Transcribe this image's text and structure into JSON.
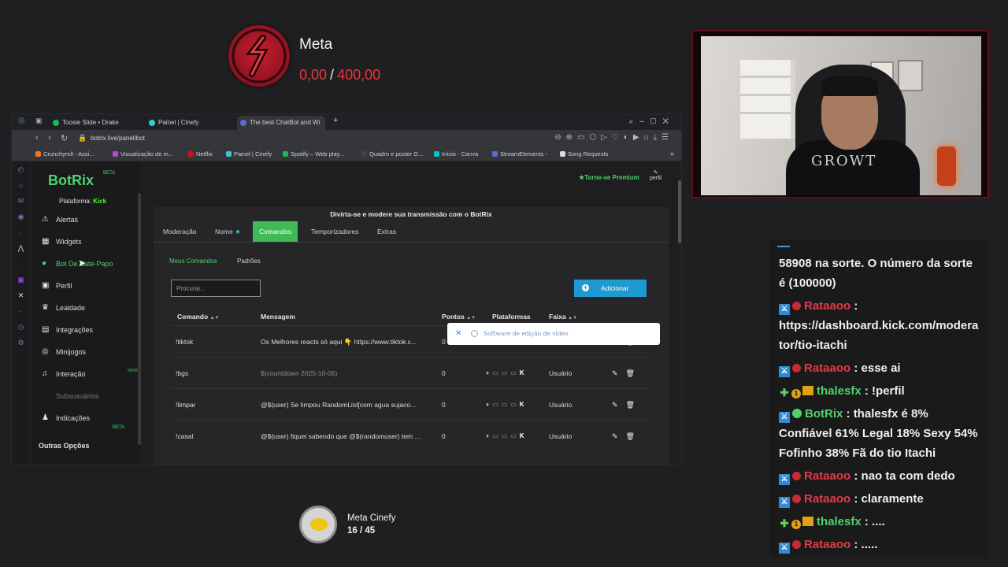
{
  "meta_top": {
    "title": "Meta",
    "current": "0,00",
    "separator": "/",
    "goal": "400,00",
    "accent": "#e8383f"
  },
  "meta_bottom": {
    "title": "Meta Cinefy",
    "progress": "16 / 45"
  },
  "webcam": {
    "shirt_text": "GROWT"
  },
  "browser": {
    "tabs": [
      {
        "label": "Toosie Slide • Drake",
        "color": "#1db954"
      },
      {
        "label": "Painel | Cinefy",
        "color": "#37c9d8"
      },
      {
        "label": "The best ChatBot and Wi",
        "color": "#5b6ad6"
      }
    ],
    "new_tab": "+",
    "url": "botrix.live/panel/bot",
    "bookmarks": [
      {
        "label": "Crunchyroll - Assi...",
        "color": "#f47521"
      },
      {
        "label": "Visualização de m...",
        "color": "#b04bd6"
      },
      {
        "label": "Netflix",
        "color": "#e50914"
      },
      {
        "label": "Painel | Cinefy",
        "color": "#37c9d8"
      },
      {
        "label": "Spotify – Web play...",
        "color": "#1db954"
      },
      {
        "label": "Quadro e poster G...",
        "color": "#444444"
      },
      {
        "label": "Início - Canva",
        "color": "#00c4cc"
      },
      {
        "label": "StreamElements -",
        "color": "#5b6ad6"
      },
      {
        "label": "Song Requests",
        "color": "#dddddd"
      }
    ]
  },
  "botrix": {
    "brand": "BotRix",
    "beta": "BETA",
    "platform_label": "Plataforma:",
    "platform": "Kick",
    "premium": "★Torne-se Premium",
    "profile": "perfil",
    "menu": [
      {
        "label": "Alertas",
        "icon": "⚠"
      },
      {
        "label": "Widgets",
        "icon": "▦"
      },
      {
        "label": "Bot De Bate-Papo",
        "icon": "●"
      },
      {
        "label": "Perfil",
        "icon": "▣"
      },
      {
        "label": "Lealdade",
        "icon": "♛"
      },
      {
        "label": "Integrações",
        "icon": "▤"
      },
      {
        "label": "Minijogos",
        "icon": "◎"
      },
      {
        "label": "Interação",
        "icon": "♫",
        "tag": "NOVO"
      },
      {
        "label": "Subsusuários",
        "icon": ""
      },
      {
        "label": "Indicações",
        "icon": "♟",
        "tag": "BETA"
      }
    ],
    "section": "Outras Opções",
    "banner": "Divirta-se e modere sua transmissão com o BotRix",
    "tabs": [
      "Moderação",
      "Nome",
      "Comandos",
      "Temporizadores",
      "Extras"
    ],
    "subtabs": [
      "Meus Comandos",
      "Padrões"
    ],
    "search_placeholder": "Procurar...",
    "add_label": "Adicionar",
    "columns": [
      "Comando",
      "Mensagem",
      "Pontos",
      "Plataformas",
      "Faixa"
    ],
    "rows": [
      {
        "command": "!tiktok",
        "message": "Os Melhores reacts só aqui 👇 https://www.tiktok.c...",
        "points": "0",
        "role": "Usuário"
      },
      {
        "command": "!bgs",
        "message": "$(countdown 2025-10-06)",
        "points": "0",
        "role": "Usuário"
      },
      {
        "command": "!limpar",
        "message": "@$(user) Se limpou RandomList[com agua sujaco...",
        "points": "0",
        "role": "Usuário"
      },
      {
        "command": "!casal",
        "message": "@$(user) fiquei sabendo que @$(randomuser) tem ...",
        "points": "0",
        "role": "Usuário"
      }
    ],
    "toast": "Software de edição de vídeo"
  },
  "chat": {
    "messages": [
      {
        "text": "58908 na sorte. O número da sorte é (100000)"
      },
      {
        "user": "Rataaoo",
        "sep": " :",
        "text": "https://dashboard.kick.com/moderator/tio-itachi"
      },
      {
        "user": "Rataaoo",
        "sep": " : ",
        "text": "esse ai"
      },
      {
        "user": "thalesfx",
        "sep": " : ",
        "text": "!perfil"
      },
      {
        "user": "BotRix",
        "sep": " : ",
        "text": "thalesfx é 8% Confiável 61% Legal 18% Sexy 54% Fofinho 38% Fã do tio Itachi"
      },
      {
        "user": "Rataaoo",
        "sep": " : ",
        "text": "nao ta com dedo"
      },
      {
        "user": "Rataaoo",
        "sep": " : ",
        "text": "claramente"
      },
      {
        "user": "thalesfx",
        "sep": " : ",
        "text": "...."
      },
      {
        "user": "Rataaoo",
        "sep": " : ",
        "text": "....."
      }
    ]
  }
}
